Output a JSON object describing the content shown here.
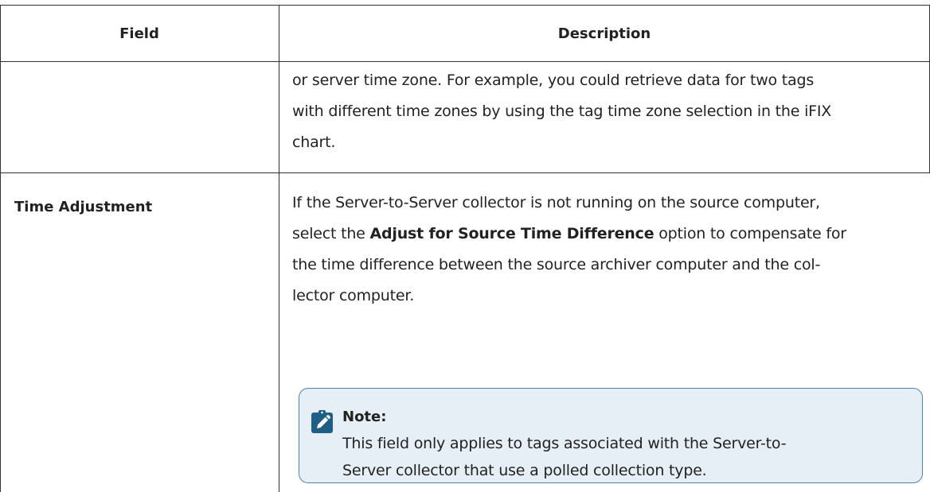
{
  "table": {
    "headers": {
      "field": "Field",
      "description": "Description"
    },
    "rows": [
      {
        "field": "",
        "description_lines": [
          "or server time zone. For example, you could retrieve data for two tags",
          "with different time zones by using the tag time zone selection in the iFIX",
          "chart."
        ]
      },
      {
        "field": "Time Adjustment",
        "description": {
          "line1": "If the Server-to-Server collector is not running on the source computer,",
          "line2_prefix": "select the ",
          "line2_bold": "Adjust for Source Time Difference",
          "line2_suffix": " option to compensate for",
          "line3": "the time difference between the source archiver computer and the col-",
          "line4": "lector computer."
        },
        "note": {
          "icon": "pencil-clipboard-icon",
          "title": "Note:",
          "lines": [
            "This field only applies to tags associated with the Server-to-",
            "Server collector that use a polled collection type."
          ]
        }
      }
    ]
  },
  "colors": {
    "border": "#333333",
    "note_border": "#4e84a8",
    "note_background": "#e6eff5",
    "note_icon": "#1f5f86",
    "text": "#222222"
  }
}
